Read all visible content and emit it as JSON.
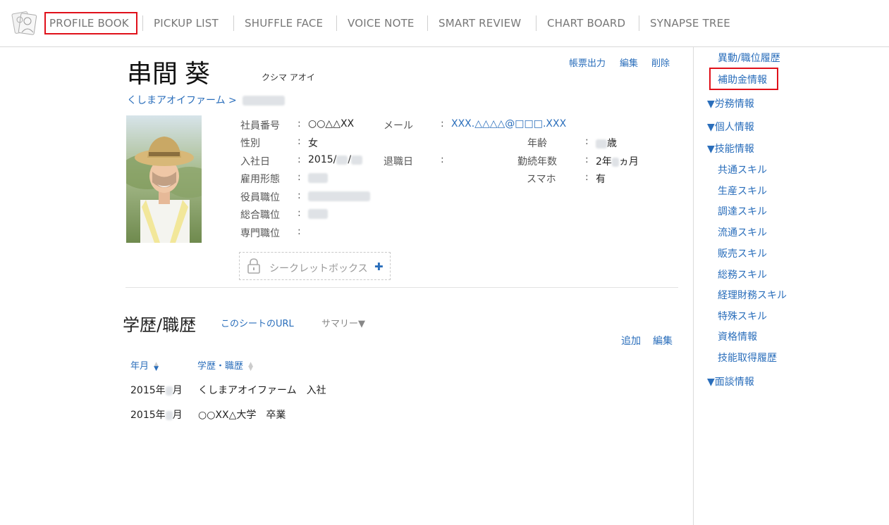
{
  "nav": {
    "items": [
      "PROFILE BOOK",
      "PICKUP LIST",
      "SHUFFLE FACE",
      "VOICE NOTE",
      "SMART REVIEW",
      "CHART BOARD",
      "SYNAPSE TREE"
    ]
  },
  "profile": {
    "name": "串間 葵",
    "kana": "クシマ アオイ",
    "actions": [
      "帳票出力",
      "編集",
      "削除"
    ],
    "breadcrumb": "くしまアオイファーム >",
    "fields": {
      "employee_no_label": "社員番号",
      "employee_no_value": "○○△△XX",
      "mail_label": "メール",
      "mail_value": "XXX.△△△△@□□□.XXX",
      "gender_label": "性別",
      "gender_value": "女",
      "age_label": "年齢",
      "age_suffix": "歳",
      "join_label": "入社日",
      "join_year": "2015/",
      "join_sep": "/",
      "retire_label": "退職日",
      "tenure_label": "勤続年数",
      "tenure_prefix": "2年",
      "tenure_suffix": "ヵ月",
      "employment_label": "雇用形態",
      "smartphone_label": "スマホ",
      "smartphone_value": "有",
      "officer_label": "役員職位",
      "general_label": "総合職位",
      "special_label": "専門職位",
      "colon": ":"
    },
    "secret_box": "シークレットボックス"
  },
  "history": {
    "title": "学歴/職歴",
    "sheet_url": "このシートのURL",
    "summary": "サマリー▼",
    "add": "追加",
    "edit": "編集",
    "columns": [
      "年月",
      "学歴・職歴"
    ],
    "rows": [
      {
        "year": "2015年",
        "month_suffix": "月",
        "desc": "くしまアオイファーム　入社"
      },
      {
        "year": "2015年",
        "month_suffix": "月",
        "desc": "○○XX△大学　卒業"
      }
    ]
  },
  "sidebar": {
    "items": [
      "異動/職位履歴",
      "補助金情報",
      "▼労務情報",
      "▼個人情報",
      "▼技能情報",
      "共通スキル",
      "生産スキル",
      "調達スキル",
      "流通スキル",
      "販売スキル",
      "総務スキル",
      "経理財務スキル",
      "特殊スキル",
      "資格情報",
      "技能取得履歴",
      "▼面談情報"
    ]
  },
  "colors": {
    "link": "#2a6ebb",
    "highlight": "#e0101a",
    "nav_text": "#777777"
  }
}
